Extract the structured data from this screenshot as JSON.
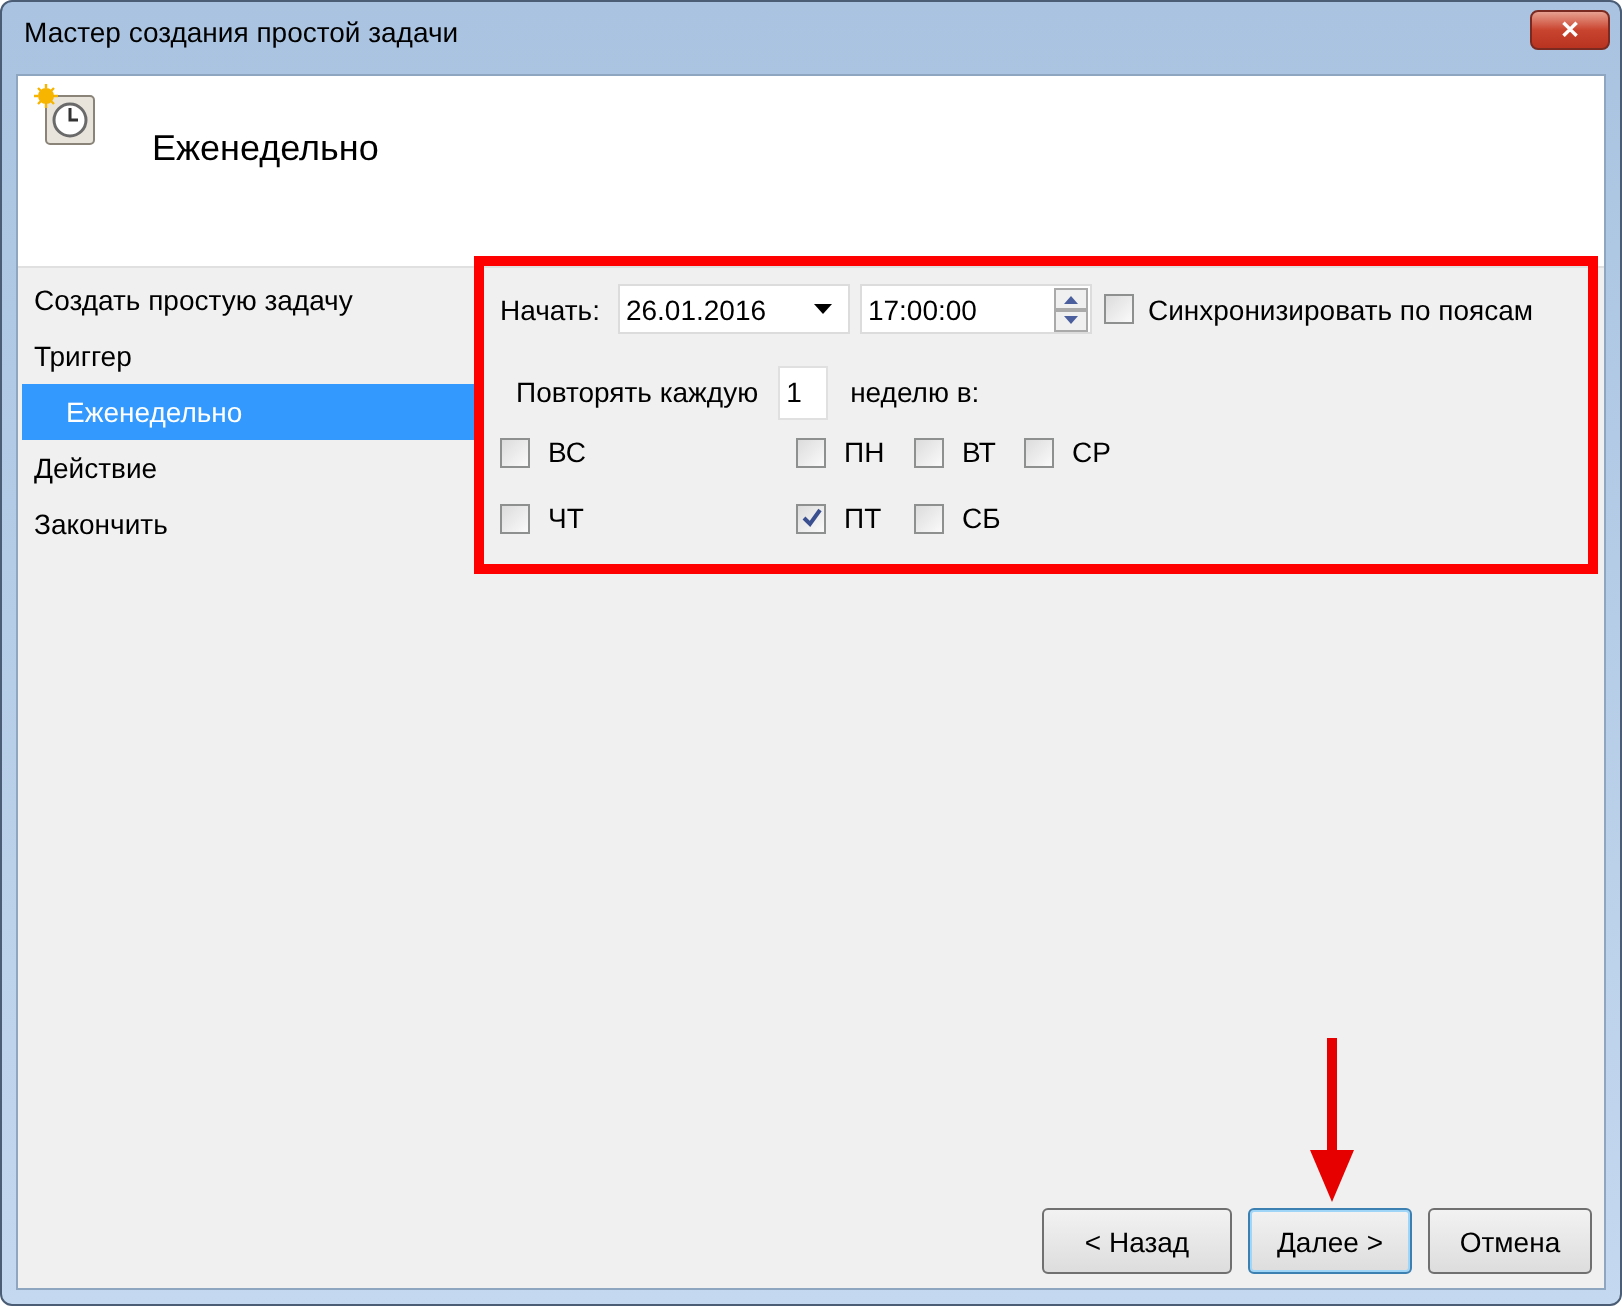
{
  "window": {
    "title": "Мастер создания простой задачи",
    "close": "✕"
  },
  "header": {
    "title": "Еженедельно"
  },
  "sidebar": {
    "items": [
      {
        "label": "Создать простую задачу",
        "selected": false
      },
      {
        "label": "Триггер",
        "selected": false,
        "children": [
          {
            "label": "Еженедельно",
            "selected": true
          }
        ]
      },
      {
        "label": "Действие",
        "selected": false
      },
      {
        "label": "Закончить",
        "selected": false
      }
    ]
  },
  "form": {
    "start_label": "Начать:",
    "date": "26.01.2016",
    "time": "17:00:00",
    "sync": {
      "label": "Синхронизировать по поясам",
      "checked": false
    },
    "repeat_label": "Повторять каждую",
    "repeat_value": "1",
    "repeat_suffix": "неделю в:",
    "days": [
      {
        "label": "ВС",
        "checked": false
      },
      {
        "label": "ПН",
        "checked": false
      },
      {
        "label": "ВТ",
        "checked": false
      },
      {
        "label": "СР",
        "checked": false
      },
      {
        "label": "ЧТ",
        "checked": false
      },
      {
        "label": "ПТ",
        "checked": true
      },
      {
        "label": "СБ",
        "checked": false
      }
    ]
  },
  "buttons": [
    {
      "label": "< Назад",
      "default": false
    },
    {
      "label": "Далее >",
      "default": true
    },
    {
      "label": "Отмена",
      "default": false
    }
  ]
}
